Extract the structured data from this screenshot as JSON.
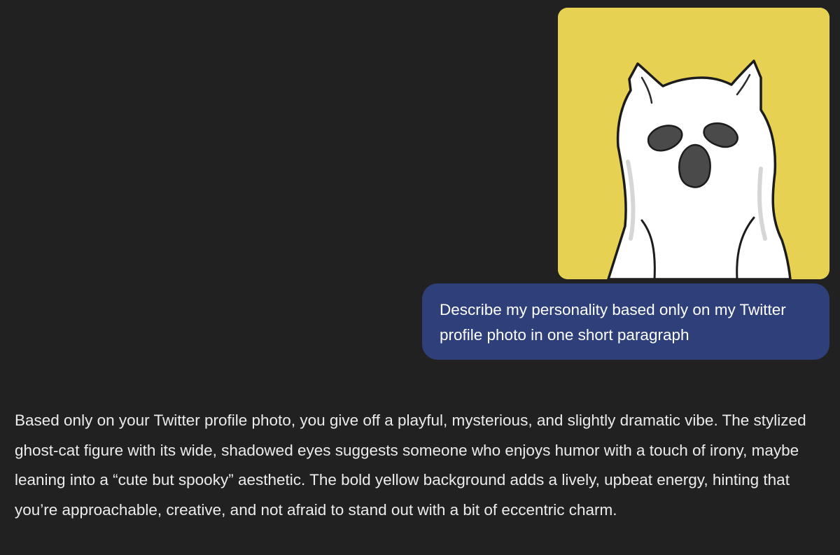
{
  "user_message": {
    "image": {
      "icon": "ghost-cat-avatar",
      "background_color": "#e7d153"
    },
    "text": "Describe my personality based only on my Twitter profile photo in one short paragraph"
  },
  "assistant_message": {
    "text": "Based only on your Twitter profile photo, you give off a playful, mysterious, and slightly dramatic vibe. The stylized ghost-cat figure with its wide, shadowed eyes suggests someone who enjoys humor with a touch of irony, maybe leaning into a “cute but spooky” aesthetic. The bold yellow background adds a lively, upbeat energy, hinting that you’re approachable, creative, and not afraid to stand out with a bit of eccentric charm."
  },
  "colors": {
    "page_background": "#212121",
    "user_bubble": "#2e3f7a",
    "text": "#ececec"
  }
}
